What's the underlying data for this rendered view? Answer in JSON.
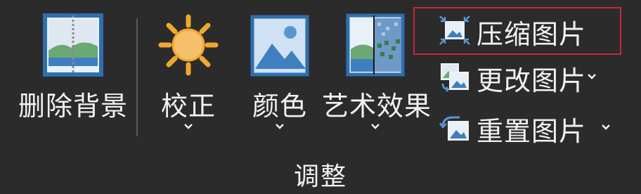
{
  "group": {
    "name": "调整"
  },
  "buttons": {
    "remove_background": "删除背景",
    "corrections": "校正",
    "color": "颜色",
    "artistic_effects": "艺术效果"
  },
  "small_buttons": {
    "compress": "压缩图片",
    "change": "更改图片",
    "reset": "重置图片"
  },
  "colors": {
    "background": "#2b2b2b",
    "text": "#f2f2f2",
    "highlight": "#c8263b",
    "picture_blue": "#2e6fb0",
    "sun": "#f0a830"
  }
}
